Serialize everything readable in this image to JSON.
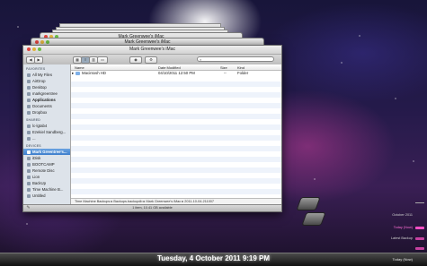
{
  "stack": {
    "titles": [
      "Mark Greenwee's iMac",
      "Mark Greenwee's iMac"
    ]
  },
  "finder": {
    "title": "Mark Greenwee's iMac",
    "search_placeholder": "",
    "status": "1 item, 10.41 GB available"
  },
  "sidebar": {
    "favorites_header": "FAVORITES",
    "favorites": [
      "All My Files",
      "AirDrop",
      "Desktop",
      "markgreentree",
      "Applications",
      "Documents",
      "Dropbox"
    ],
    "shared_header": "SHARED",
    "shared": [
      "lc-lgtab4",
      "Ezekiel Sandberg...",
      "..."
    ],
    "devices_header": "DEVICES",
    "devices": [
      "Mark Greentree's...",
      "iDisk",
      "BOOTCAMP",
      "Remote Disc",
      "Lion",
      "BackUp",
      "Time Machine B...",
      "Untitled"
    ]
  },
  "files": {
    "columns": [
      "Name",
      "Date Modified",
      "Size",
      "Kind"
    ],
    "rows": [
      {
        "name": "Macintosh HD",
        "date": "04/10/2011 12:50 PM",
        "size": "--",
        "kind": "Folder"
      }
    ]
  },
  "pathbar": [
    "Time Machine Backups",
    "Backups.backupdb",
    "Mark Greenwee's iMac",
    "2011-10-04-211007"
  ],
  "timeline": [
    "October 2011",
    "Today (Now)",
    "Latest Backup"
  ],
  "bottom": {
    "date": "Tuesday, 4 October 2011 9:19 PM",
    "today": "Today (Now)"
  },
  "colors": {
    "accent_pink": "#ff4fc6",
    "selection_blue": "#3f7fcc",
    "sidebar_bg": "#dde3ea"
  }
}
